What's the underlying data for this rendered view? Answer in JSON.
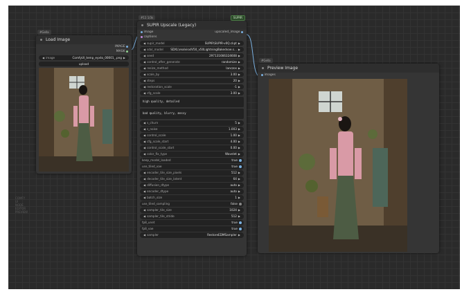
{
  "load_image": {
    "id_tag": "#Gella",
    "title": "Load Image",
    "outputs": [
      "IMAGE",
      "MASK"
    ],
    "image_label": "image",
    "image_value": "ComfyUI_temp_eyxto_00001_.png",
    "upload_label": "upload"
  },
  "supir": {
    "id_tag": "#11 1/3s",
    "badge": "SUPIR",
    "title": "SUPIR Upscale (Legacy)",
    "inputs": [
      "image",
      "captions"
    ],
    "output": "upscaled_image",
    "widgets_top": [
      {
        "label": "supir_model",
        "value": "SUPIR\\SUPIR-v0Q.ckpt"
      },
      {
        "label": "sdxl_model",
        "value": "SDXL\\realvisxlV50_v50LightningBakedvae.s..."
      },
      {
        "label": "seed",
        "value": "297131666324608"
      },
      {
        "label": "control_after_generate",
        "value": "randomize"
      },
      {
        "label": "resize_method",
        "value": "lanczos"
      },
      {
        "label": "scale_by",
        "value": "3.00"
      },
      {
        "label": "steps",
        "value": "20"
      },
      {
        "label": "restoration_scale",
        "value": "-1"
      },
      {
        "label": "cfg_scale",
        "value": "3.00"
      }
    ],
    "positive_prompt": "high quality, detailed",
    "negative_prompt": "bad quality, blurry, messy",
    "widgets_bottom": [
      {
        "label": "s_churn",
        "value": "5",
        "toggle": false
      },
      {
        "label": "s_noise",
        "value": "1.003",
        "toggle": false
      },
      {
        "label": "control_scale",
        "value": "1.00",
        "toggle": false
      },
      {
        "label": "cfg_scale_start",
        "value": "4.00",
        "toggle": false
      },
      {
        "label": "control_scale_start",
        "value": "0.00",
        "toggle": false
      },
      {
        "label": "color_fix_type",
        "value": "Wavelet",
        "toggle": false
      },
      {
        "label": "keep_model_loaded",
        "value": "true",
        "toggle": true
      },
      {
        "label": "use_tiled_vae",
        "value": "true",
        "toggle": true
      },
      {
        "label": "encoder_tile_size_pixels",
        "value": "512",
        "toggle": false
      },
      {
        "label": "decoder_tile_size_latent",
        "value": "64",
        "toggle": false
      },
      {
        "label": "diffusion_dtype",
        "value": "auto",
        "toggle": false
      },
      {
        "label": "encoder_dtype",
        "value": "auto",
        "toggle": false
      },
      {
        "label": "batch_size",
        "value": "1",
        "toggle": false
      },
      {
        "label": "use_tiled_sampling",
        "value": "false",
        "toggle": true
      },
      {
        "label": "sampler_tile_size",
        "value": "1024",
        "toggle": false
      },
      {
        "label": "sampler_tile_stride",
        "value": "512",
        "toggle": false
      },
      {
        "label": "fp8_unet",
        "value": "true",
        "toggle": true
      },
      {
        "label": "fp8_vae",
        "value": "true",
        "toggle": true
      },
      {
        "label": "sampler",
        "value": "RestoreEDMSampler",
        "toggle": false
      }
    ]
  },
  "preview": {
    "id_tag": "#Gella",
    "title": "Preview Image",
    "input": "images"
  },
  "watermark_lines": [
    "COMFY",
    "UI",
    "NODE",
    "EDITOR",
    "PREVIEW"
  ],
  "colors": {
    "canvas": "#2a2a2a",
    "node": "#353535",
    "link": "#7ab0e0"
  }
}
